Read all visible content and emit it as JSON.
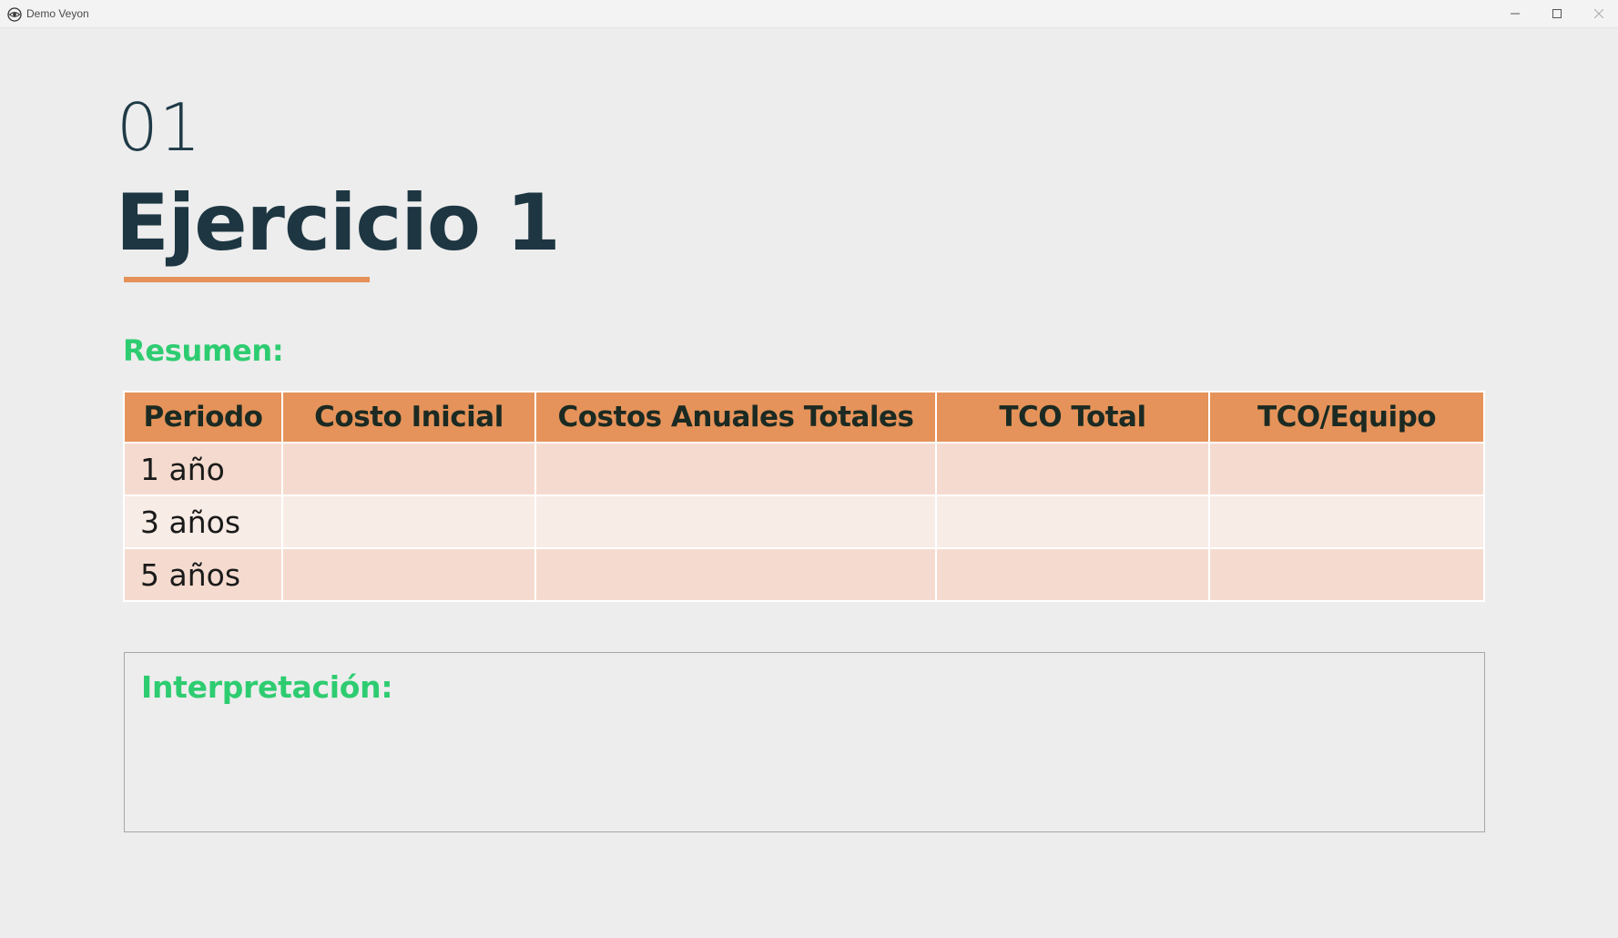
{
  "window": {
    "title": "Demo Veyon",
    "app_icon": "veyon-eye-icon",
    "controls": {
      "minimize_icon": "minimize-icon",
      "maximize_icon": "maximize-icon",
      "close_icon": "close-icon"
    }
  },
  "slide": {
    "number": "01",
    "title": "Ejercicio 1",
    "summary_label": "Resumen:",
    "interpretation_label": "Interpretación:"
  },
  "table": {
    "headers": [
      "Periodo",
      "Costo Inicial",
      "Costos Anuales Totales",
      "TCO Total",
      "TCO/Equipo"
    ],
    "rows": [
      {
        "periodo": "1 año",
        "costo_inicial": "",
        "costos_anuales": "",
        "tco_total": "",
        "tco_equipo": ""
      },
      {
        "periodo": "3 años",
        "costo_inicial": "",
        "costos_anuales": "",
        "tco_total": "",
        "tco_equipo": ""
      },
      {
        "periodo": "5 años",
        "costo_inicial": "",
        "costos_anuales": "",
        "tco_total": "",
        "tco_equipo": ""
      }
    ]
  },
  "colors": {
    "accent_orange": "#e5935a",
    "accent_green": "#2ecc71",
    "title_navy": "#1d3642",
    "row_dark": "#f5dbcf",
    "row_light": "#f8ece6"
  }
}
